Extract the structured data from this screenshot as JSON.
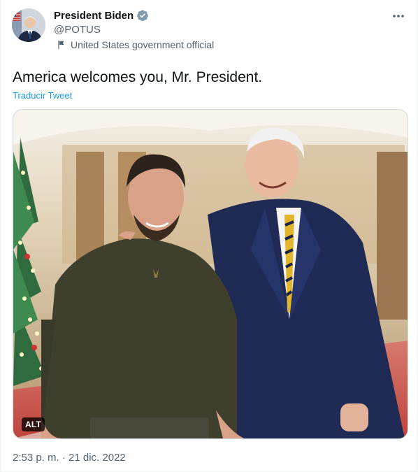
{
  "author": {
    "display_name": "President Biden",
    "handle": "@POTUS",
    "verified_icon": "verified-badge-icon",
    "label": "United States government official",
    "label_icon": "flag-icon",
    "avatar_alt": "avatar"
  },
  "tweet": {
    "text": "America welcomes you, Mr. President.",
    "translate_link": "Traducir Tweet",
    "media": {
      "alt_badge": "ALT"
    },
    "timestamp": "2:53 p. m. · 21 dic. 2022"
  },
  "menu": {
    "icon": "more-dots-icon"
  },
  "colors": {
    "link": "#1d9bf0",
    "secondary_text": "#536471",
    "verified": "#829aab",
    "border": "#cfd9de"
  }
}
